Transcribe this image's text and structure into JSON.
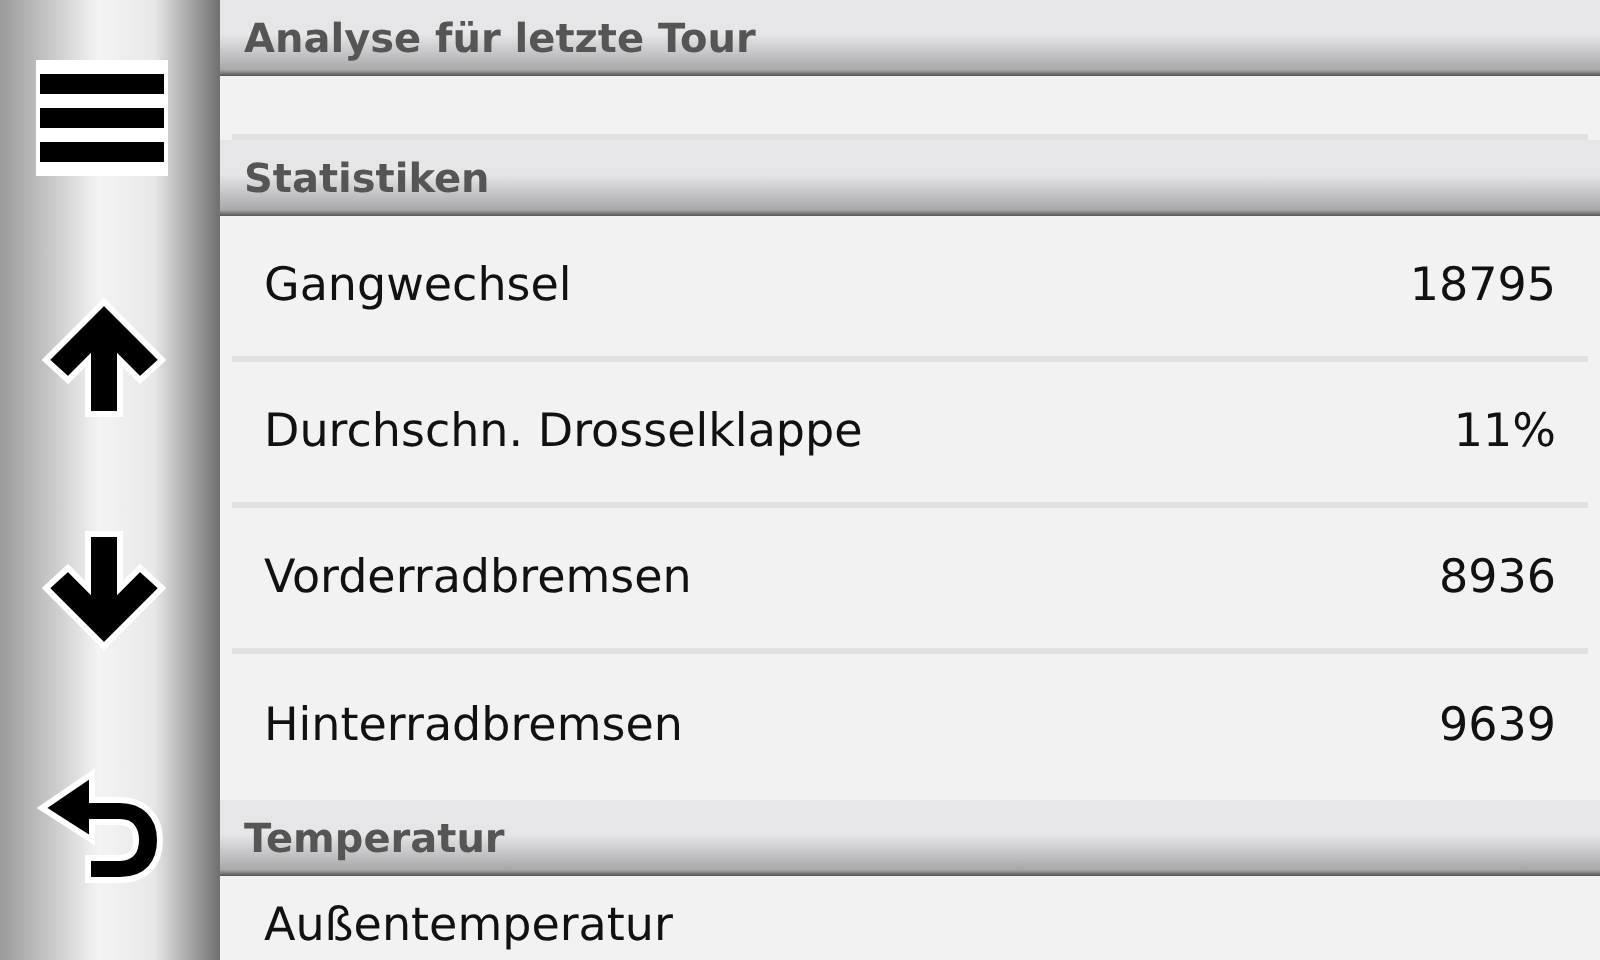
{
  "title": "Analyse für letzte Tour",
  "sections": [
    {
      "heading": "Statistiken",
      "rows": [
        {
          "label": "Gangwechsel",
          "value": "18795"
        },
        {
          "label": "Durchschn. Drosselklappe",
          "value": "11%"
        },
        {
          "label": "Vorderradbremsen",
          "value": "8936"
        },
        {
          "label": "Hinterradbremsen",
          "value": "9639"
        }
      ]
    },
    {
      "heading": "Temperatur",
      "rows": [
        {
          "label": "Außentemperatur"
        }
      ]
    }
  ]
}
